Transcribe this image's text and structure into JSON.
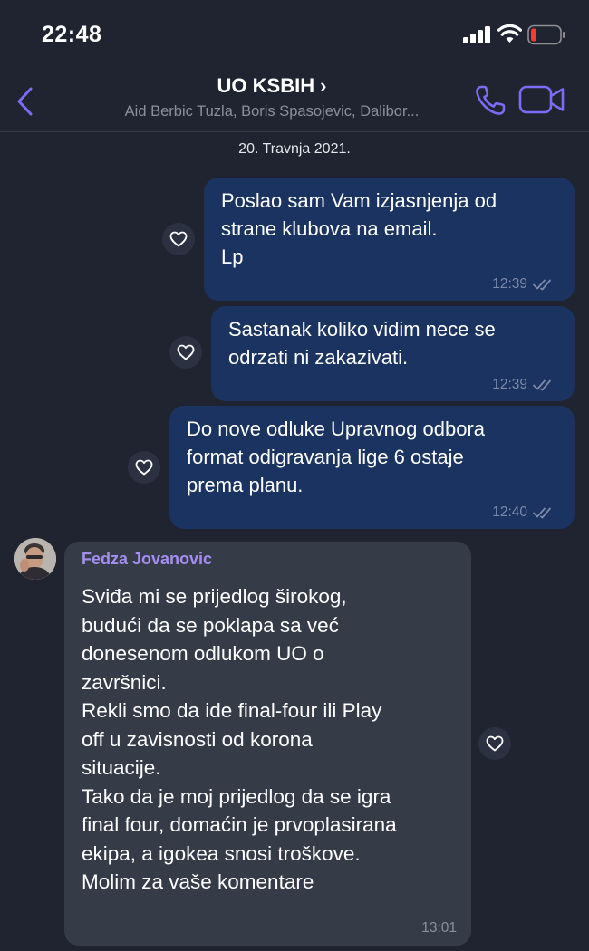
{
  "status_bar": {
    "time": "22:48",
    "icons": [
      "signal-icon",
      "wifi-icon",
      "battery-low-icon"
    ],
    "battery_color": "#ff3b30"
  },
  "header": {
    "title": "UO KSBIH",
    "title_chevron": "›",
    "subtitle": "Aid Berbic Tuzla, Boris Spasojevic, Dalibor...",
    "icons": [
      "back-chevron-icon",
      "phone-icon",
      "video-camera-icon"
    ],
    "accent_color": "#7b6cf6"
  },
  "date_separator": "20. Travnja 2021.",
  "messages": [
    {
      "direction": "outgoing",
      "text": "Poslao sam Vam izjasnjenja od\nstrane klubova na email.\nLp",
      "time": "12:39",
      "status": "read"
    },
    {
      "direction": "outgoing",
      "text": "Sastanak koliko vidim nece se\nodrzati ni zakazivati.",
      "time": "12:39",
      "status": "read"
    },
    {
      "direction": "outgoing",
      "text": "Do nove odluke Upravnog odbora\nformat odigravanja lige 6 ostaje\nprema planu.",
      "time": "12:40",
      "status": "read"
    },
    {
      "direction": "incoming",
      "sender": "Fedza Jovanovic",
      "text": "Sviđa mi se prijedlog širokog,\nbudući da se poklapa sa već\ndonesenom odlukom UO o\nzavršnici.\nRekli smo da ide final-four ili Play\noff u zavisnosti od korona\nsituacije.\nTako da je moj prijedlog da se igra\nfinal four, domaćin je prvoplasirana\nekipa, a igokea snosi troškove.\nMolim za vaše komentare",
      "time": "13:01"
    }
  ],
  "colors": {
    "background": "#1f2430",
    "outgoing_bubble": "#1b3361",
    "incoming_bubble": "#363b48",
    "sender_name": "#a58ef0"
  }
}
